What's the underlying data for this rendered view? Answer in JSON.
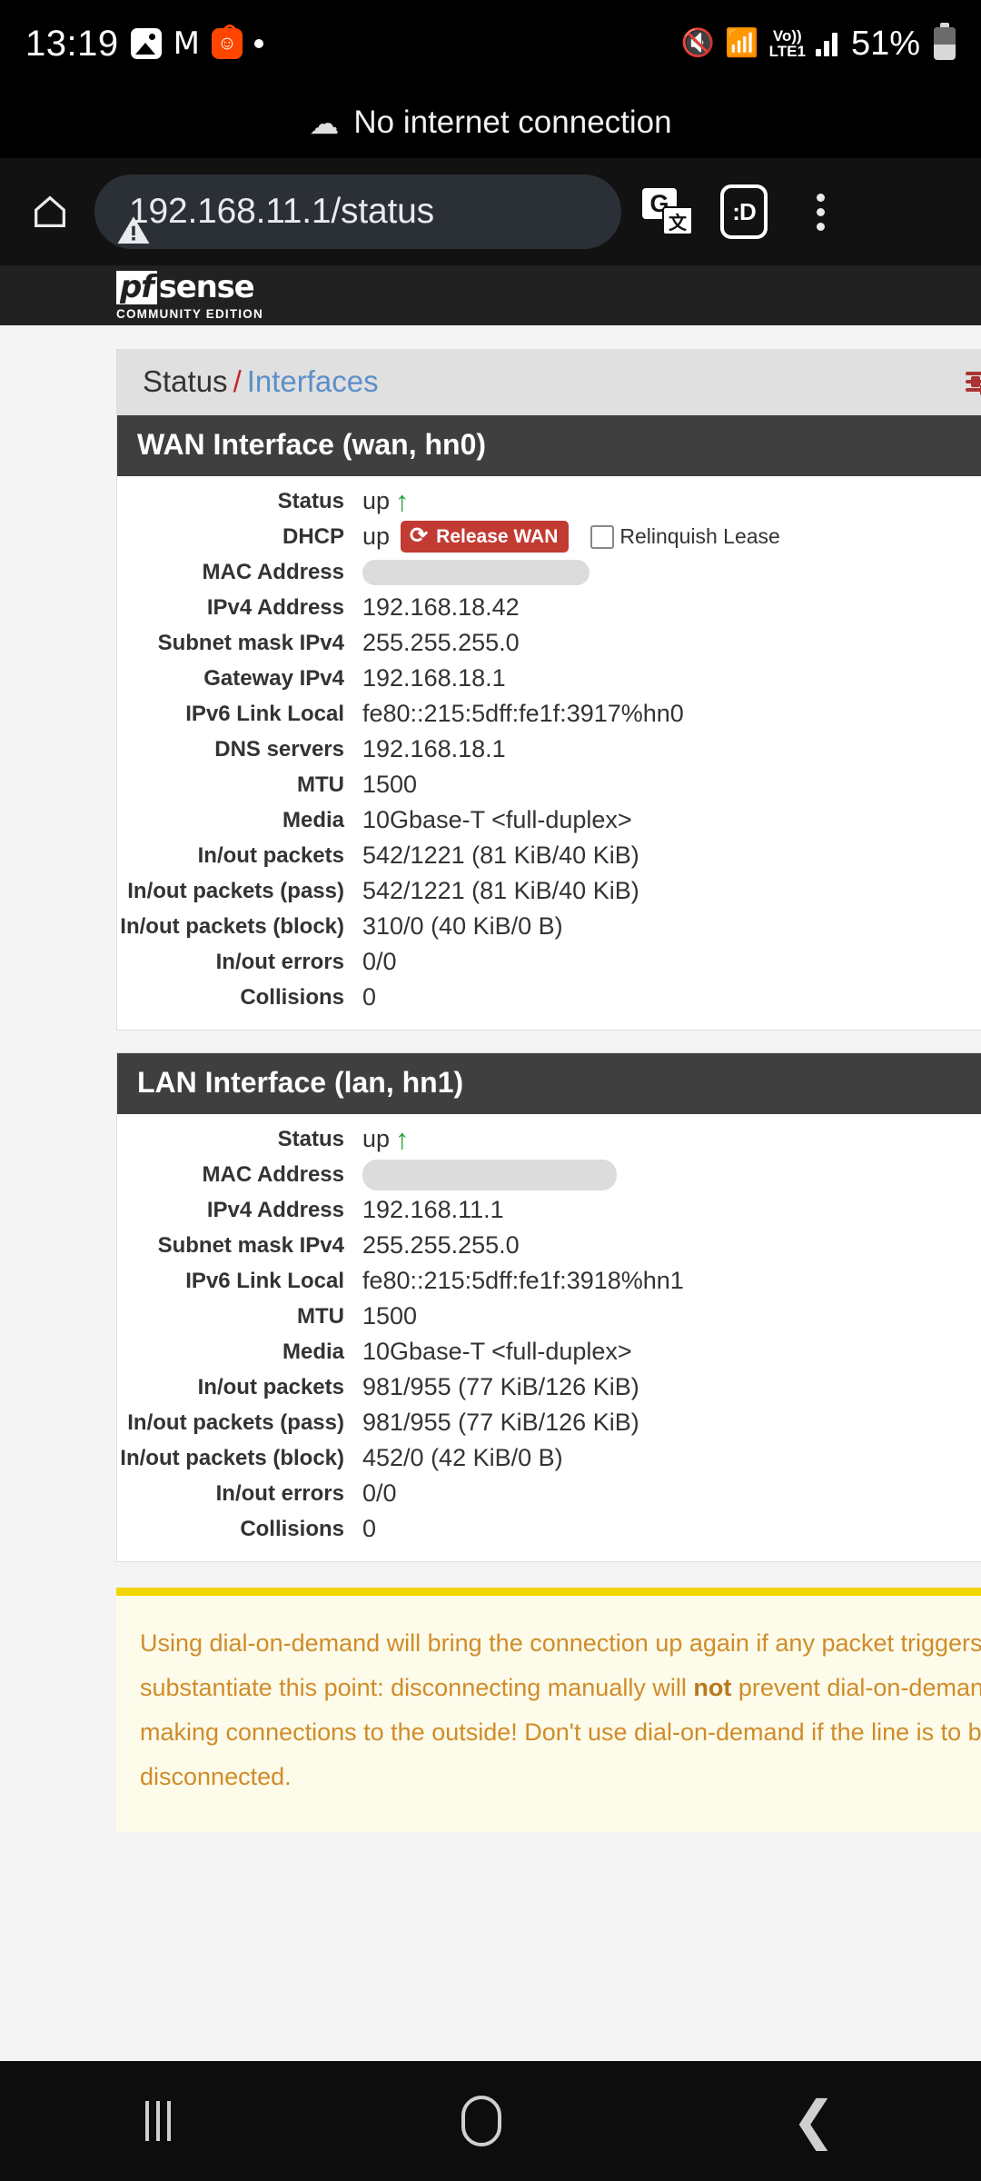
{
  "status_bar": {
    "time": "13:19",
    "icons": [
      "photos-icon",
      "gmail-icon",
      "reddit-icon",
      "dot-icon"
    ],
    "mute_icon": "mute-icon",
    "wifi_icon": "wifi-alert-icon",
    "volte_top": "Vo))",
    "volte_bottom": "LTE1",
    "battery_percent": "51%"
  },
  "offline_banner": {
    "text": "No internet connection",
    "icon": "cloud-off-icon"
  },
  "browser": {
    "home_icon": "home-icon",
    "security_icon": "not-secure-warning-icon",
    "url": "192.168.11.1/status",
    "translate_icon": "translate-icon",
    "translate_g": "G",
    "translate_cjk": "文",
    "profile_icon": "smiley-face-icon",
    "profile_label": ":D",
    "menu_icon": "overflow-menu-icon"
  },
  "pfsense": {
    "brand_pf": "pf",
    "brand_sense": "sense",
    "brand_sub": "COMMUNITY EDITION",
    "breadcrumb": {
      "root": "Status",
      "separator": "/",
      "current": "Interfaces"
    },
    "filter_icon": "sliders-filter-icon"
  },
  "wan_panel": {
    "title": "WAN Interface (wan, hn0)",
    "status_label": "Status",
    "status_value": "up",
    "dhcp_label": "DHCP",
    "dhcp_value": "up",
    "release_button": "Release WAN",
    "release_icon": "refresh-icon",
    "relinquish_label": "Relinquish Lease",
    "mac_label": "MAC Address",
    "mac_value": "",
    "rows": [
      {
        "label": "IPv4 Address",
        "value": "192.168.18.42"
      },
      {
        "label": "Subnet mask IPv4",
        "value": "255.255.255.0"
      },
      {
        "label": "Gateway IPv4",
        "value": "192.168.18.1"
      },
      {
        "label": "IPv6 Link Local",
        "value": "fe80::215:5dff:fe1f:3917%hn0"
      },
      {
        "label": "DNS servers",
        "value": "192.168.18.1"
      },
      {
        "label": "MTU",
        "value": "1500"
      },
      {
        "label": "Media",
        "value": "10Gbase-T <full-duplex>"
      },
      {
        "label": "In/out packets",
        "value": "542/1221 (81 KiB/40 KiB)"
      },
      {
        "label": "In/out packets (pass)",
        "value": "542/1221 (81 KiB/40 KiB)"
      },
      {
        "label": "In/out packets (block)",
        "value": "310/0 (40 KiB/0 B)"
      },
      {
        "label": "In/out errors",
        "value": "0/0"
      },
      {
        "label": "Collisions",
        "value": "0"
      }
    ]
  },
  "lan_panel": {
    "title": "LAN Interface (lan, hn1)",
    "status_label": "Status",
    "status_value": "up",
    "mac_label": "MAC Address",
    "mac_value": "",
    "rows": [
      {
        "label": "IPv4 Address",
        "value": "192.168.11.1"
      },
      {
        "label": "Subnet mask IPv4",
        "value": "255.255.255.0"
      },
      {
        "label": "IPv6 Link Local",
        "value": "fe80::215:5dff:fe1f:3918%hn1"
      },
      {
        "label": "MTU",
        "value": "1500"
      },
      {
        "label": "Media",
        "value": "10Gbase-T <full-duplex>"
      },
      {
        "label": "In/out packets",
        "value": "981/955 (77 KiB/126 KiB)"
      },
      {
        "label": "In/out packets (pass)",
        "value": "981/955 (77 KiB/126 KiB)"
      },
      {
        "label": "In/out packets (block)",
        "value": "452/0 (42 KiB/0 B)"
      },
      {
        "label": "In/out errors",
        "value": "0/0"
      },
      {
        "label": "Collisions",
        "value": "0"
      }
    ]
  },
  "alert": {
    "line1": "Using dial-on-demand will bring the connection up again if any packet triggers i",
    "line2_a": "substantiate this point: disconnecting manually will ",
    "line2_b": "not",
    "line2_c": " prevent dial-on-deman",
    "line3": "making connections to the outside! Don't use dial-on-demand if the line is to be",
    "line4": "disconnected."
  },
  "nav_bar": {
    "recents_icon": "recents-icon",
    "home_icon": "home-circle-icon",
    "back_icon": "back-chevron-icon"
  }
}
